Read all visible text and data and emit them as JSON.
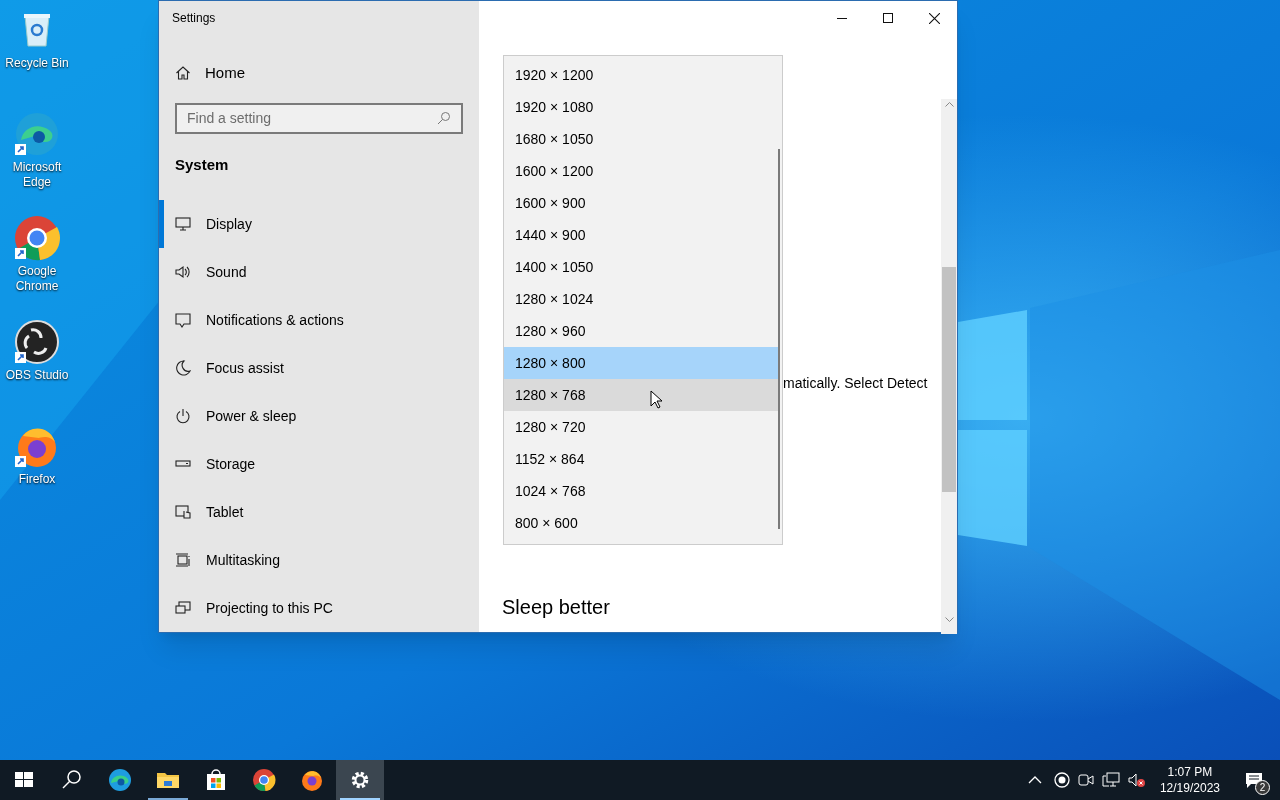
{
  "desktop_icons": [
    {
      "label": "Recycle Bin"
    },
    {
      "label": "Microsoft Edge"
    },
    {
      "label": "Google Chrome"
    },
    {
      "label": "OBS Studio"
    },
    {
      "label": "Firefox"
    }
  ],
  "window": {
    "title": "Settings"
  },
  "sidebar": {
    "home": "Home",
    "search": {
      "placeholder": "Find a setting"
    },
    "section": "System",
    "items": [
      {
        "label": "Display",
        "selected": true
      },
      {
        "label": "Sound",
        "selected": false
      },
      {
        "label": "Notifications & actions",
        "selected": false
      },
      {
        "label": "Focus assist",
        "selected": false
      },
      {
        "label": "Power & sleep",
        "selected": false
      },
      {
        "label": "Storage",
        "selected": false
      },
      {
        "label": "Tablet",
        "selected": false
      },
      {
        "label": "Multitasking",
        "selected": false
      },
      {
        "label": "Projecting to this PC",
        "selected": false
      }
    ]
  },
  "content": {
    "partial_text": "matically. Select Detect",
    "heading": "Sleep better"
  },
  "dropdown": {
    "options": [
      {
        "label": "1920 × 1200",
        "selected": false,
        "hovered": false
      },
      {
        "label": "1920 × 1080",
        "selected": false,
        "hovered": false
      },
      {
        "label": "1680 × 1050",
        "selected": false,
        "hovered": false
      },
      {
        "label": "1600 × 1200",
        "selected": false,
        "hovered": false
      },
      {
        "label": "1600 × 900",
        "selected": false,
        "hovered": false
      },
      {
        "label": "1440 × 900",
        "selected": false,
        "hovered": false
      },
      {
        "label": "1400 × 1050",
        "selected": false,
        "hovered": false
      },
      {
        "label": "1280 × 1024",
        "selected": false,
        "hovered": false
      },
      {
        "label": "1280 × 960",
        "selected": false,
        "hovered": false
      },
      {
        "label": "1280 × 800",
        "selected": true,
        "hovered": false
      },
      {
        "label": "1280 × 768",
        "selected": false,
        "hovered": true
      },
      {
        "label": "1280 × 720",
        "selected": false,
        "hovered": false
      },
      {
        "label": "1152 × 864",
        "selected": false,
        "hovered": false
      },
      {
        "label": "1024 × 768",
        "selected": false,
        "hovered": false
      },
      {
        "label": "800 × 600",
        "selected": false,
        "hovered": false
      }
    ]
  },
  "taskbar": {
    "apps": [
      {
        "running": false,
        "active": false
      },
      {
        "running": true,
        "active": false
      },
      {
        "running": false,
        "active": false
      },
      {
        "running": false,
        "active": false
      },
      {
        "running": false,
        "active": false
      },
      {
        "running": true,
        "active": true
      }
    ],
    "time": "1:07 PM",
    "date": "12/19/2023",
    "notification_count": "2"
  }
}
